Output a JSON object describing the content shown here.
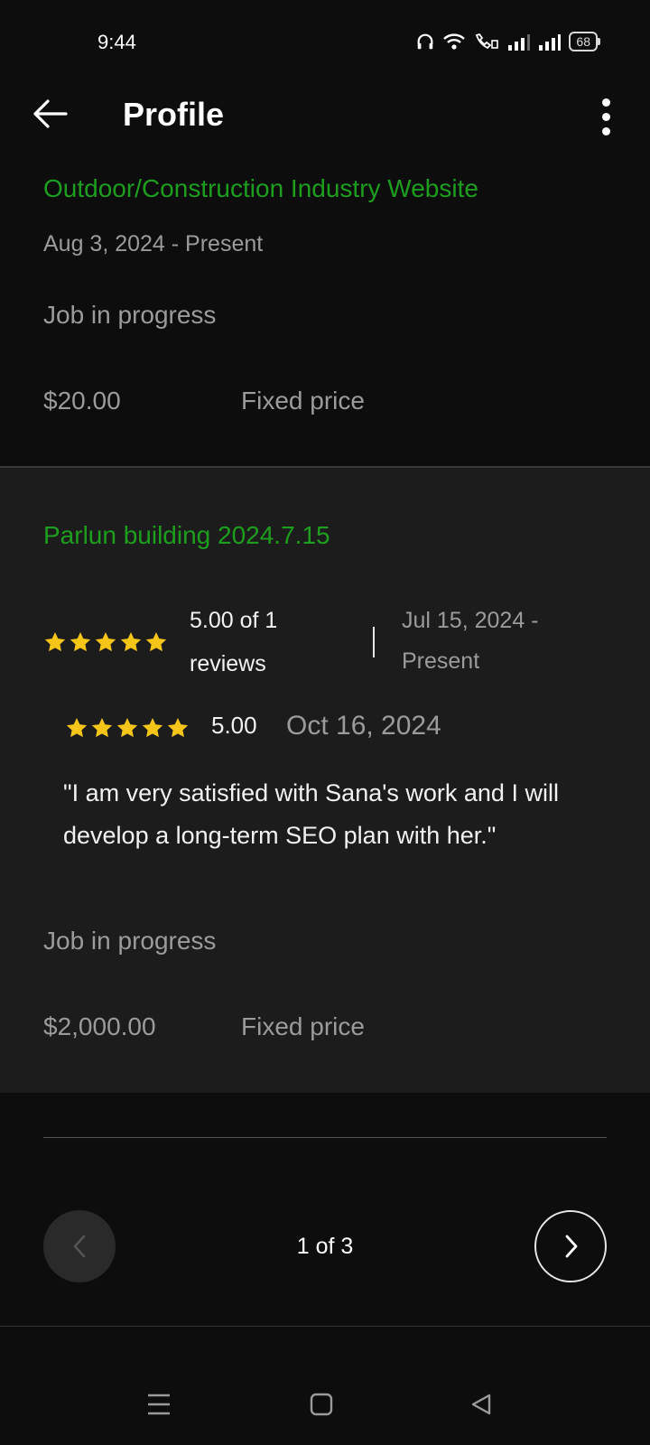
{
  "status_bar": {
    "time": "9:44",
    "battery": "68",
    "icons": [
      "headphones-icon",
      "wifi-icon",
      "volte-call-icon",
      "signal-icon",
      "signal-icon"
    ]
  },
  "header": {
    "title": "Profile",
    "back_icon": "arrow-left-icon",
    "menu_icon": "more-vertical-icon"
  },
  "jobs": [
    {
      "title": "Outdoor/Construction Industry Website",
      "dates": "Aug 3, 2024 - Present",
      "status": "Job in progress",
      "amount": "$20.00",
      "price_type": "Fixed price"
    },
    {
      "title": "Parlun building 2024.7.15",
      "rating_summary_line1": "5.00 of 1",
      "rating_summary_line2": "reviews",
      "rating_stars": 5,
      "dates_line1": "Jul 15, 2024 -",
      "dates_line2": "Present",
      "review": {
        "stars": 5,
        "score": "5.00",
        "date": "Oct 16, 2024",
        "text": "\"I am very satisfied with Sana's work and I will develop a long-term SEO plan with her.\""
      },
      "status": "Job in progress",
      "amount": "$2,000.00",
      "price_type": "Fixed price"
    }
  ],
  "pagination": {
    "label": "1 of 3",
    "prev_icon": "chevron-left-icon",
    "next_icon": "chevron-right-icon"
  },
  "nav_bar": {
    "icons": [
      "recent-apps-icon",
      "home-icon",
      "back-triangle-icon"
    ]
  },
  "colors": {
    "background": "#0d0d0d",
    "card": "#1c1c1c",
    "accent_green": "#1e9e1e",
    "star_yellow": "#f5c518",
    "muted_text": "#9b9b9b"
  }
}
